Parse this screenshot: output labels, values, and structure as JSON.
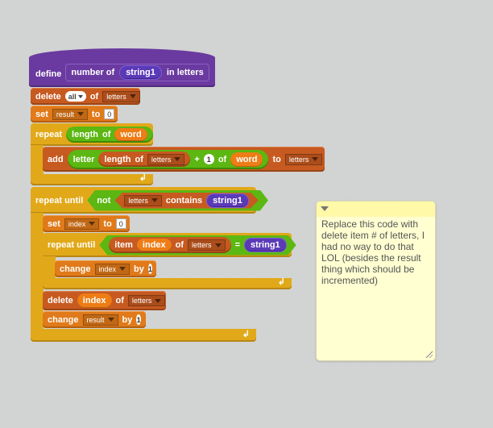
{
  "script": {
    "define": {
      "keyword": "define",
      "label_pre": "number of",
      "param": "string1",
      "label_post": "in letters"
    },
    "delete_all": {
      "keyword": "delete",
      "which": "all",
      "of": "of",
      "list": "letters"
    },
    "set_result": {
      "keyword": "set",
      "var": "result",
      "to": "to",
      "value": "0"
    },
    "repeat1": {
      "keyword": "repeat",
      "expr_a": "length",
      "expr_of": "of",
      "expr_b": "word"
    },
    "add": {
      "keyword": "add",
      "letter": "letter",
      "length": "length",
      "of1": "of",
      "list1": "letters",
      "plus": "+",
      "one": "1",
      "of2": "of",
      "word": "word",
      "to": "to",
      "list2": "letters"
    },
    "repeat_until1": {
      "keyword": "repeat until",
      "not": "not",
      "list": "letters",
      "contains": "contains",
      "param": "string1"
    },
    "set_index": {
      "keyword": "set",
      "var": "index",
      "to": "to",
      "value": "0"
    },
    "repeat_until2": {
      "keyword": "repeat until",
      "item": "item",
      "index": "index",
      "of": "of",
      "list": "letters",
      "eq": "=",
      "param": "string1"
    },
    "change_index": {
      "keyword": "change",
      "var": "index",
      "by": "by",
      "value": "1"
    },
    "delete_index": {
      "keyword": "delete",
      "index": "index",
      "of": "of",
      "list": "letters"
    },
    "change_result": {
      "keyword": "change",
      "var": "result",
      "by": "by",
      "value": "1"
    },
    "loop_arrow": "↲"
  },
  "comment": {
    "text": "Replace this code with delete item # of letters, I had no way to do that LOL (besides the result thing which should be incremented)"
  }
}
